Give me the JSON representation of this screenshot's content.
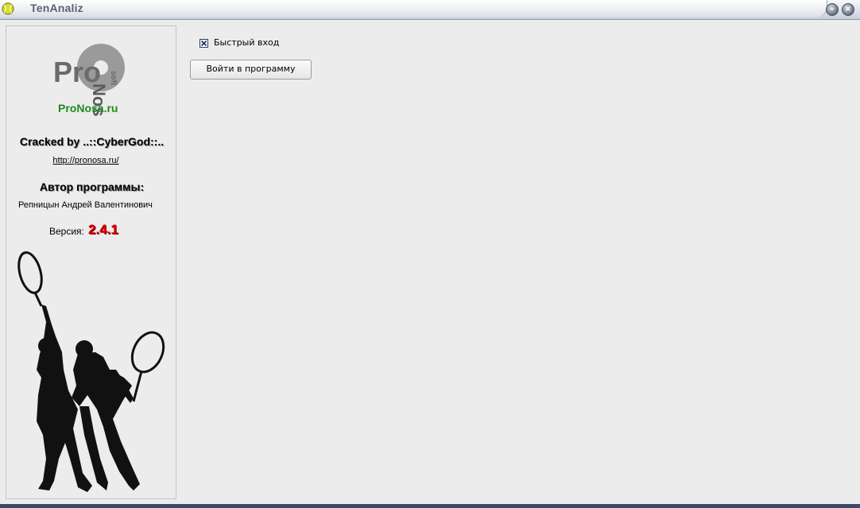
{
  "window": {
    "title": "TenAnaliz",
    "controls": {
      "minimize": "–",
      "close": "×"
    }
  },
  "sidebar": {
    "logo_text_top": "Pro",
    "logo_text_vertical": "Nosa",
    "logo_text_soft": "soft",
    "logo_caption": "ProNosa.ru",
    "cracked_by": "Cracked by ..::CyberGod::..",
    "link": "http://pronosa.ru/",
    "author_heading": "Автор программы:",
    "author_name": "Репницын Андрей Валентинович",
    "version_label": "Версия:",
    "version_value": "2.4.1"
  },
  "main": {
    "quick_login_label": "Быстрый вход",
    "quick_login_checked": true,
    "login_button": "Войти в программу"
  },
  "colors": {
    "version": "#e00000",
    "window_bg": "#ececec",
    "frame": "#3b4a66"
  }
}
